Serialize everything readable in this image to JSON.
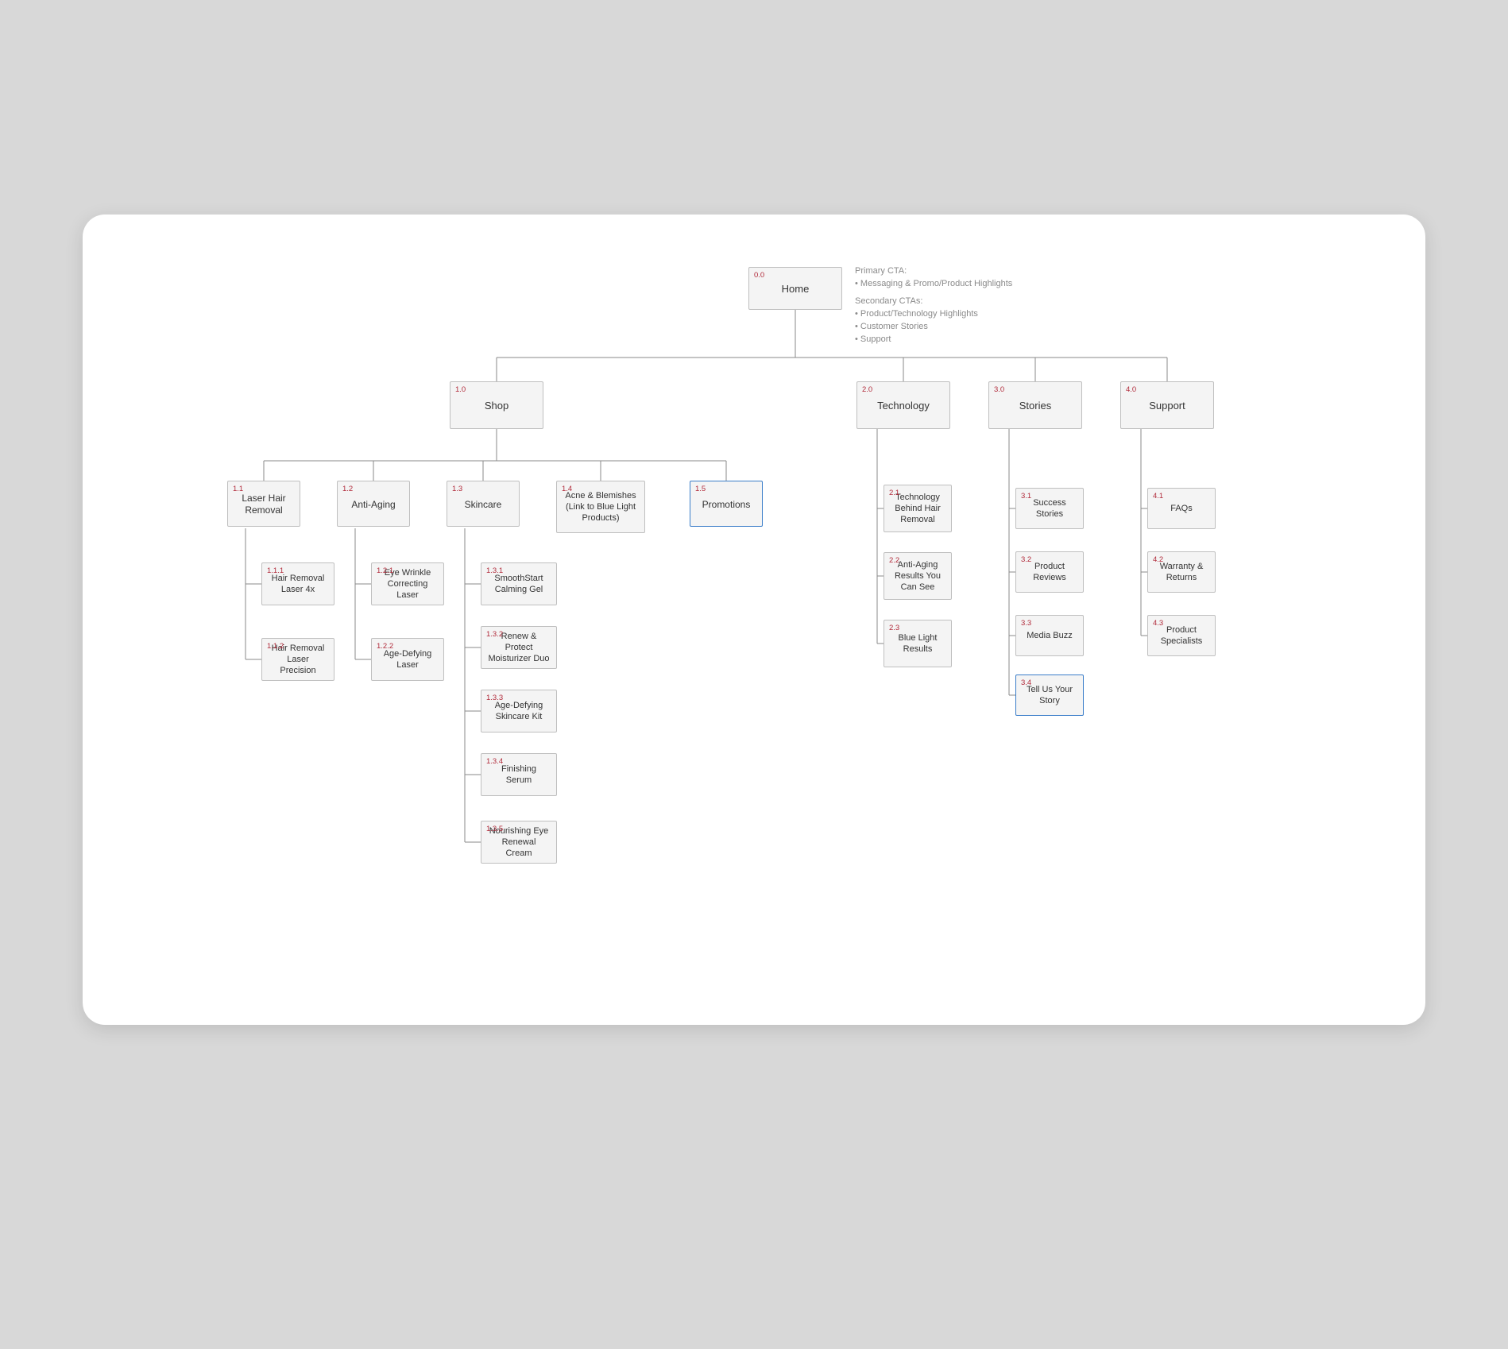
{
  "root": {
    "num": "0.0",
    "label": "Home"
  },
  "notes": {
    "primary_hdr": "Primary CTA:",
    "primary_1": "• Messaging & Promo/Product Highlights",
    "secondary_hdr": "Secondary CTAs:",
    "secondary_1": "• Product/Technology Highlights",
    "secondary_2": "• Customer Stories",
    "secondary_3": "• Support"
  },
  "level1": {
    "shop": {
      "num": "1.0",
      "label": "Shop"
    },
    "technology": {
      "num": "2.0",
      "label": "Technology"
    },
    "stories": {
      "num": "3.0",
      "label": "Stories"
    },
    "support": {
      "num": "4.0",
      "label": "Support"
    }
  },
  "shop_children": {
    "laser_hair": {
      "num": "1.1",
      "label": "Laser Hair Removal"
    },
    "anti_aging": {
      "num": "1.2",
      "label": "Anti-Aging"
    },
    "skincare": {
      "num": "1.3",
      "label": "Skincare"
    },
    "acne": {
      "num": "1.4",
      "label": "Acne & Blemishes (Link to Blue Light Products)"
    },
    "promotions": {
      "num": "1.5",
      "label": "Promotions"
    }
  },
  "laser_hair_children": {
    "p1": {
      "num": "1.1.1",
      "label": "Hair Removal Laser 4x"
    },
    "p2": {
      "num": "1.1.2",
      "label": "Hair Removal Laser Precision"
    }
  },
  "anti_aging_children": {
    "p1": {
      "num": "1.2.1",
      "label": "Eye Wrinkle Correcting Laser"
    },
    "p2": {
      "num": "1.2.2",
      "label": "Age-Defying Laser"
    }
  },
  "skincare_children": {
    "p1": {
      "num": "1.3.1",
      "label": "SmoothStart Calming Gel"
    },
    "p2": {
      "num": "1.3.2",
      "label": "Renew & Protect Moisturizer Duo"
    },
    "p3": {
      "num": "1.3.3",
      "label": "Age-Defying Skincare Kit"
    },
    "p4": {
      "num": "1.3.4",
      "label": "Finishing Serum"
    },
    "p5": {
      "num": "1.3.5",
      "label": "Nourishing Eye Renewal Cream"
    }
  },
  "technology_children": {
    "p1": {
      "num": "2.1",
      "label": "Technology Behind Hair Removal"
    },
    "p2": {
      "num": "2.2",
      "label": "Anti-Aging Results You Can See"
    },
    "p3": {
      "num": "2.3",
      "label": "Blue Light Results"
    }
  },
  "stories_children": {
    "p1": {
      "num": "3.1",
      "label": "Success Stories"
    },
    "p2": {
      "num": "3.2",
      "label": "Product Reviews"
    },
    "p3": {
      "num": "3.3",
      "label": "Media Buzz"
    },
    "p4": {
      "num": "3.4",
      "label": "Tell Us Your Story"
    }
  },
  "support_children": {
    "p1": {
      "num": "4.1",
      "label": "FAQs"
    },
    "p2": {
      "num": "4.2",
      "label": "Warranty & Returns"
    },
    "p3": {
      "num": "4.3",
      "label": "Product Specialists"
    }
  }
}
